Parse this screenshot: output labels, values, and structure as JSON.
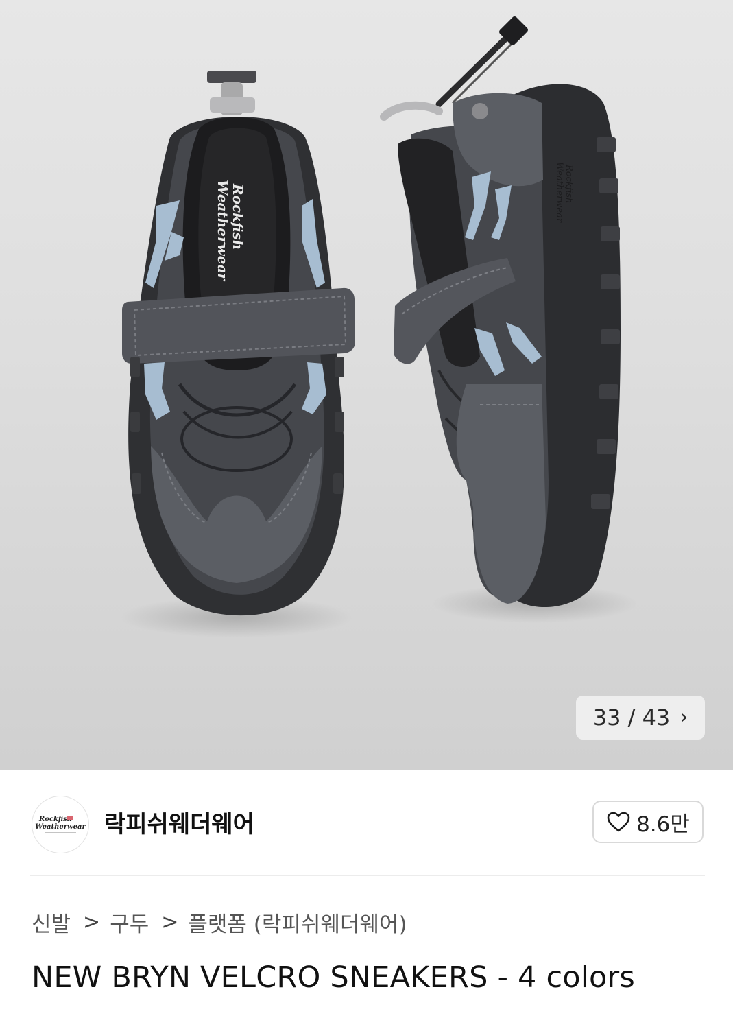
{
  "gallery": {
    "image_alt": "",
    "counter": {
      "current": "33",
      "separator": " / ",
      "total": "43"
    },
    "next_icon": "chevron-right-icon",
    "insole_text_1": "Rockfish",
    "insole_text_2": "Weatherwear",
    "sole_text_1": "Rockfish",
    "sole_text_2": "Weatherwear"
  },
  "brand": {
    "name": "락피쉬웨더웨어",
    "logo_line_1": "Rockfish",
    "logo_line_2": "Weatherwear",
    "like_icon": "heart-icon",
    "like_count": "8.6만"
  },
  "breadcrumb": {
    "items": [
      "신발",
      "구두",
      "플랫폼 (락피쉬웨더웨어)"
    ],
    "separator": ">"
  },
  "product": {
    "title": "NEW BRYN VELCRO SNEAKERS - 4 colors"
  },
  "colors": {
    "gallery_bg": "#dedede",
    "shoe_dark": "#3b3c40",
    "shoe_suede": "#5b5e64",
    "accent_blue": "#a7bdd1",
    "divider": "#ececec"
  }
}
